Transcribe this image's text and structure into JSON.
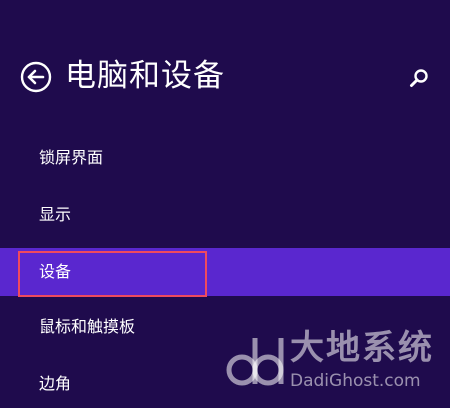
{
  "header": {
    "title": "电脑和设备",
    "back_icon": "back-arrow-circle-icon",
    "search_icon": "search-icon"
  },
  "menu": {
    "items": [
      {
        "label": "锁屏界面",
        "selected": false
      },
      {
        "label": "显示",
        "selected": false
      },
      {
        "label": "设备",
        "selected": true
      },
      {
        "label": "鼠标和触摸板",
        "selected": false
      },
      {
        "label": "边角",
        "selected": false
      }
    ]
  },
  "colors": {
    "background": "#1f0b4d",
    "selected_item": "#5a27cf",
    "annotation_box": "#f04a5e",
    "text": "#ffffff"
  },
  "watermark": {
    "text_cn": "大地系统",
    "text_en": "DadiGhost.com",
    "logo": "dd-logo"
  }
}
